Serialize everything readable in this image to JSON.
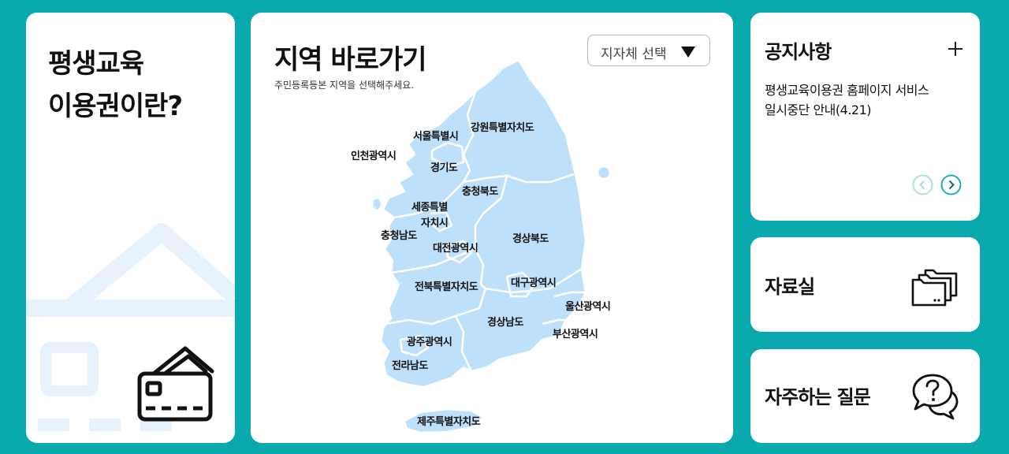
{
  "intro": {
    "title": "평생교육\n이용권이란?"
  },
  "map": {
    "title": "지역 바로가기",
    "subtitle": "주민등록등본 지역을 선택해주세요.",
    "select_label": "지자체 선택",
    "regions": [
      {
        "label": "강원특별자치도"
      },
      {
        "label": "서울특별시"
      },
      {
        "label": "인천광역시"
      },
      {
        "label": "경기도"
      },
      {
        "label": "충청북도"
      },
      {
        "label": "세종특별"
      },
      {
        "label": "자치시"
      },
      {
        "label": "충청남도"
      },
      {
        "label": "대전광역시"
      },
      {
        "label": "경상북도"
      },
      {
        "label": "대구광역시"
      },
      {
        "label": "전북특별자치도"
      },
      {
        "label": "울산광역시"
      },
      {
        "label": "경상남도"
      },
      {
        "label": "부산광역시"
      },
      {
        "label": "광주광역시"
      },
      {
        "label": "전라남도"
      },
      {
        "label": "제주특별자치도"
      }
    ]
  },
  "notice": {
    "title": "공지사항",
    "item": "평생교육이용권 홈페이지 서비스\n일시중단 안내(4.21)"
  },
  "archive": {
    "title": "자료실"
  },
  "faq": {
    "title": "자주하는 질문"
  },
  "colors": {
    "background": "#0aa9ad",
    "map_fill": "#bfe0fb",
    "accent": "#0aa9ad"
  }
}
